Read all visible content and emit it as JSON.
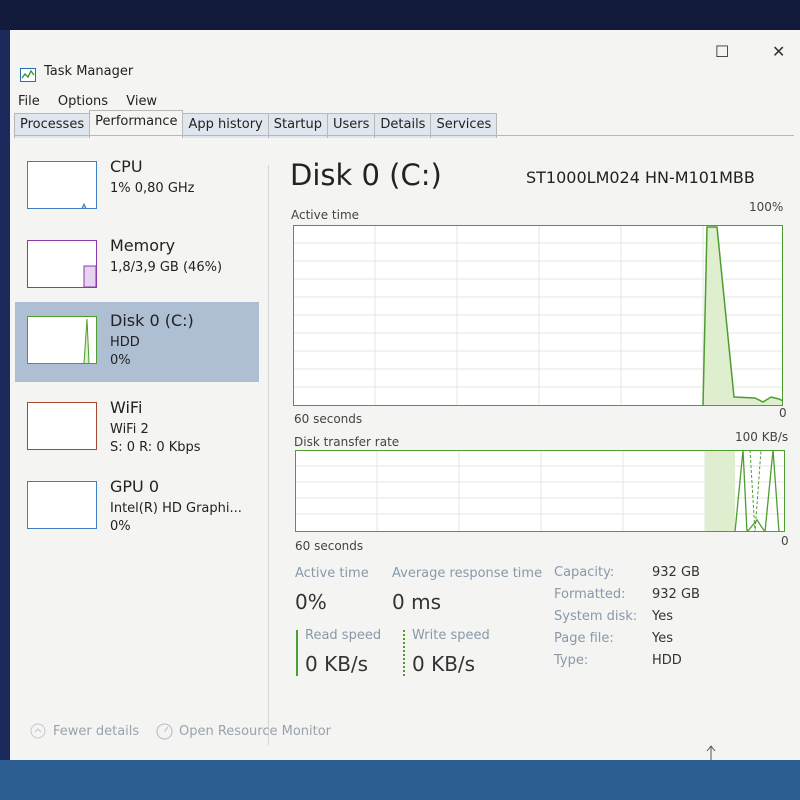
{
  "window": {
    "title": "Task Manager"
  },
  "menu": [
    "File",
    "Options",
    "View"
  ],
  "tabs": [
    "Processes",
    "Performance",
    "App history",
    "Startup",
    "Users",
    "Details",
    "Services"
  ],
  "active_tab": "Performance",
  "sidebar": [
    {
      "name": "CPU",
      "sub1": "1% 0,80 GHz",
      "sub2": ""
    },
    {
      "name": "Memory",
      "sub1": "1,8/3,9 GB (46%)",
      "sub2": ""
    },
    {
      "name": "Disk 0 (C:)",
      "sub1": "HDD",
      "sub2": "0%"
    },
    {
      "name": "WiFi",
      "sub1": "WiFi 2",
      "sub2": "S: 0 R: 0 Kbps"
    },
    {
      "name": "GPU 0",
      "sub1": "Intel(R) HD Graphi...",
      "sub2": "0%"
    }
  ],
  "main": {
    "title": "Disk 0 (C:)",
    "model": "ST1000LM024 HN-M101MBB",
    "graph1": {
      "label": "Active time",
      "max": "100%",
      "time": "60 seconds",
      "min": "0"
    },
    "graph2": {
      "label": "Disk transfer rate",
      "max": "100 KB/s",
      "time": "60 seconds",
      "min": "0"
    }
  },
  "stats": {
    "active_time_label": "Active time",
    "active_time_value": "0%",
    "avg_response_label": "Average response time",
    "avg_response_value": "0 ms",
    "read_label": "Read speed",
    "read_value": "0 KB/s",
    "write_label": "Write speed",
    "write_value": "0 KB/s"
  },
  "props": [
    {
      "label": "Capacity:",
      "value": "932 GB"
    },
    {
      "label": "Formatted:",
      "value": "932 GB"
    },
    {
      "label": "System disk:",
      "value": "Yes"
    },
    {
      "label": "Page file:",
      "value": "Yes"
    },
    {
      "label": "Type:",
      "value": "HDD"
    }
  ],
  "footer": {
    "fewer": "Fewer details",
    "monitor": "Open Resource Monitor"
  },
  "colors": {
    "disk_line": "#4c9e2e",
    "disk_fill": "#dfeecf",
    "selected_bg": "#aebed3",
    "grid": "#e3e9de"
  }
}
